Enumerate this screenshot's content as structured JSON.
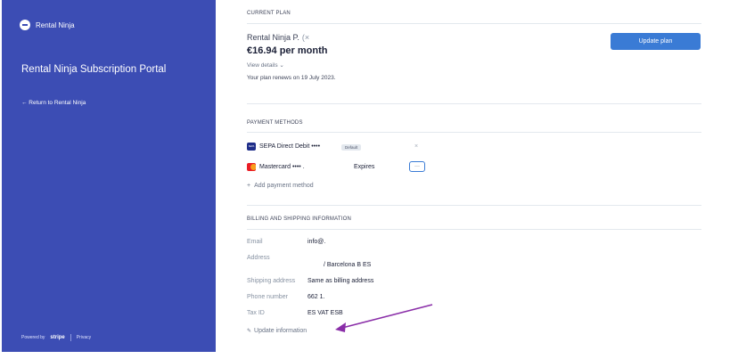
{
  "sidebar": {
    "brand": "Rental Ninja",
    "portal_title": "Rental Ninja Subscription Portal",
    "return_link": "← Return to Rental Ninja",
    "powered_by": "Powered by",
    "stripe": "stripe",
    "privacy": "Privacy"
  },
  "current_plan": {
    "label": "CURRENT PLAN",
    "name": "Rental Ninja P.",
    "name_suffix": "(×",
    "price": "€16.94 per month",
    "view_details": "View details",
    "renews": "Your plan renews on 19 July 2023.",
    "update_button": "Update plan"
  },
  "payment_methods": {
    "label": "PAYMENT METHODS",
    "methods": [
      {
        "name": "SEPA Direct Debit ••••",
        "icon": "sepa-icon",
        "badge": "Default",
        "action": "×"
      },
      {
        "name": "Mastercard •••• .",
        "icon": "mastercard-icon",
        "expires": "Expires",
        "action": "···"
      }
    ],
    "add": "Add payment method",
    "add_icon": "+"
  },
  "billing": {
    "label": "BILLING AND SHIPPING INFORMATION",
    "email_label": "Email",
    "email_value": "info@.",
    "address_label": "Address",
    "address_value": "/ Barcelona B ES",
    "shipping_label": "Shipping address",
    "shipping_value": "Same as billing address",
    "phone_label": "Phone number",
    "phone_value": "662 1.",
    "tax_label": "Tax ID",
    "tax_value": "ES VAT ESB",
    "update": "Update information",
    "update_icon": "✎"
  },
  "colors": {
    "sidebar": "#3c4db4",
    "accent": "#3a7bd5",
    "annotation_arrow": "#8a2ea8"
  }
}
